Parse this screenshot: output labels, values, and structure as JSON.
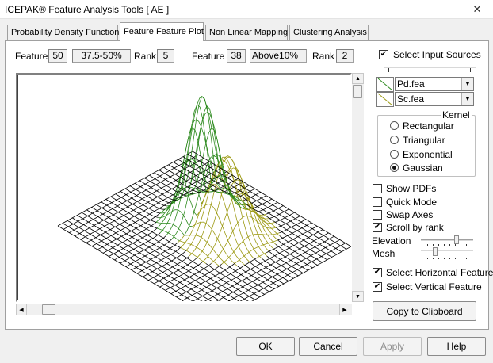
{
  "window": {
    "title": "ICEPAK® Feature Analysis Tools [ AE ]",
    "close_glyph": "✕"
  },
  "tabs": [
    {
      "label": "Probability Density Function",
      "active": false
    },
    {
      "label": "Feature Feature Plot",
      "active": true
    },
    {
      "label": "Non Linear Mapping",
      "active": false
    },
    {
      "label": "Clustering Analysis",
      "active": false
    }
  ],
  "feature_left": {
    "feature_label": "Feature",
    "feature_value": "50",
    "range_value": "37.5-50%",
    "rank_label": "Rank",
    "rank_value": "5"
  },
  "feature_right": {
    "feature_label": "Feature",
    "feature_value": "38",
    "range_value": "Above10%",
    "rank_label": "Rank",
    "rank_value": "2"
  },
  "plot": {
    "surface_colors": {
      "grid": "#000000",
      "green": "#2d8a1e",
      "olive": "#9d9a14"
    }
  },
  "input_sources": {
    "label": "Select Input Sources",
    "checked": true,
    "sources": [
      {
        "value": "Pd.fea",
        "color": "#2d8a1e"
      },
      {
        "value": "Sc.fea",
        "color": "#9d9a14"
      }
    ]
  },
  "kernel": {
    "title": "Kernel",
    "options": [
      "Rectangular",
      "Triangular",
      "Exponential",
      "Gaussian"
    ],
    "selected": "Gaussian"
  },
  "options": {
    "show_pdfs": {
      "label": "Show PDFs",
      "checked": false
    },
    "quick_mode": {
      "label": "Quick Mode",
      "checked": false
    },
    "swap_axes": {
      "label": "Swap Axes",
      "checked": false
    },
    "scroll_by_rank": {
      "label": "Scroll by rank",
      "checked": true
    }
  },
  "sliders": {
    "elevation_label": "Elevation",
    "mesh_label": "Mesh"
  },
  "select_horizontal": {
    "label": "Select Horizontal Feature",
    "checked": true
  },
  "select_vertical": {
    "label": "Select Vertical Feature",
    "checked": true
  },
  "copy_button": "Copy to Clipboard",
  "footer": {
    "ok": "OK",
    "cancel": "Cancel",
    "apply": "Apply",
    "help": "Help"
  },
  "glyphs": {
    "check": "✔",
    "arrow_up": "▲",
    "arrow_down": "▼",
    "arrow_left": "◀",
    "arrow_right": "▶"
  }
}
